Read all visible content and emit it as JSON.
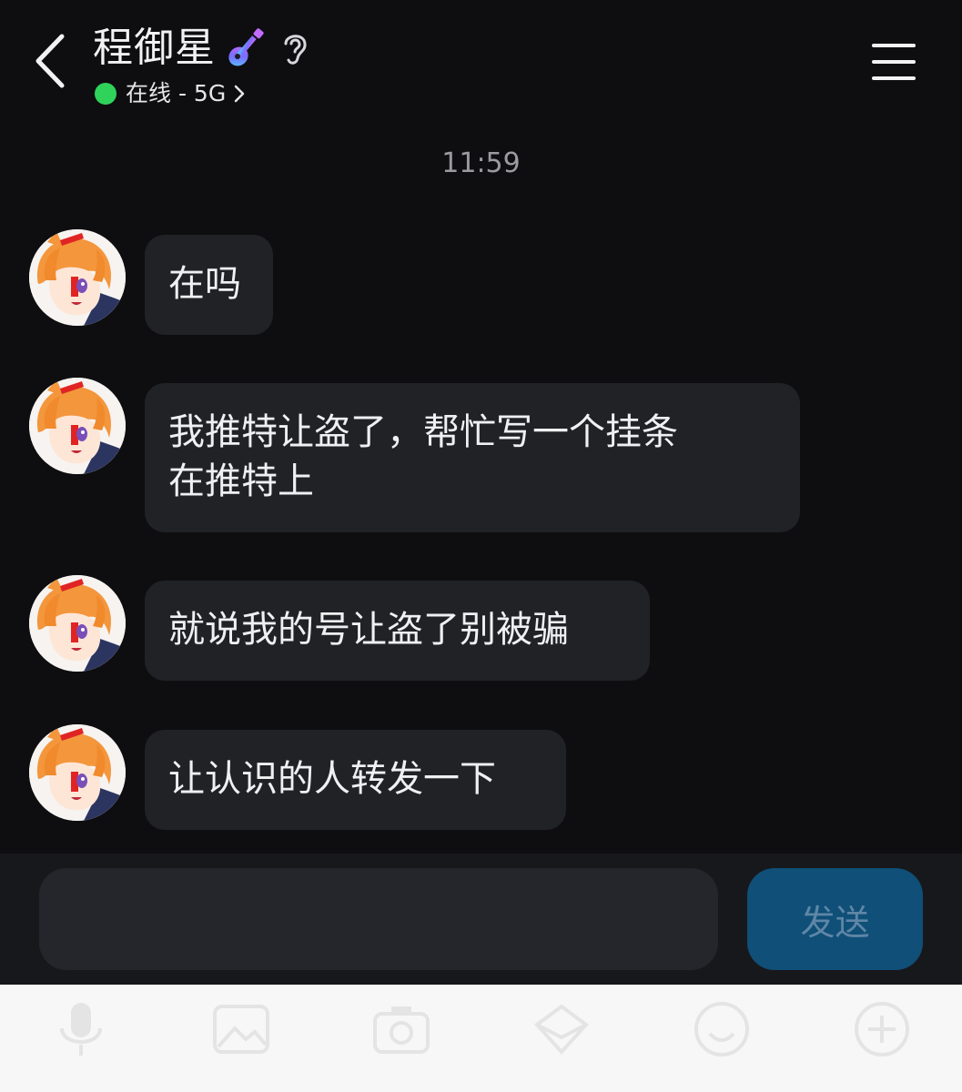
{
  "header": {
    "contact_name": "程御星",
    "status_text": "在线 - 5G",
    "status_color": "#2fd35a"
  },
  "chat": {
    "timestamp": "11:59",
    "messages": [
      {
        "text": "在吗"
      },
      {
        "text": "我推特让盗了，帮忙写一个挂条\n在推特上"
      },
      {
        "text": "就说我的号让盗了别被骗"
      },
      {
        "text": "让认识的人转发一下"
      }
    ]
  },
  "composer": {
    "input_value": "",
    "send_label": "发送",
    "send_color": "#0f4f78"
  },
  "toolbar": {
    "icons": [
      "microphone-icon",
      "image-icon",
      "camera-icon",
      "red-packet-icon",
      "emoji-icon",
      "more-icon"
    ]
  }
}
